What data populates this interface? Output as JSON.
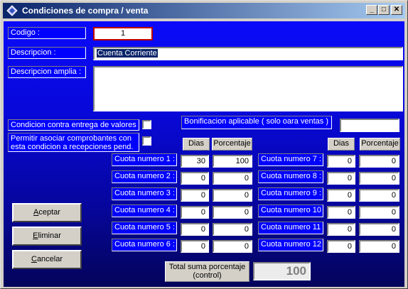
{
  "window": {
    "title": "Condiciones de compra / venta"
  },
  "fields": {
    "codigo": {
      "label": "Codigo :",
      "value": "1"
    },
    "descripcion": {
      "label": "Descripcion :",
      "value": "Cuenta Corriente"
    },
    "descripcion_amplia": {
      "label": "Descripcion amplia :",
      "value": ""
    },
    "contra_entrega": {
      "label": "Condicion contra entrega de valores :"
    },
    "permitir_asociar": {
      "label": "Permitir asociar comprobantes con esta condicion a recepciones pend."
    },
    "bonificacion": {
      "label": "Bonificacion aplicable ( solo oara ventas ) :",
      "value": ""
    }
  },
  "headers": {
    "dias": "Dias",
    "porcentaje": "Porcentaje"
  },
  "cuotas_left": [
    {
      "label": "Cuota numero 1 :",
      "dias": "30",
      "porcentaje": "100"
    },
    {
      "label": "Cuota numero 2 :",
      "dias": "0",
      "porcentaje": "0"
    },
    {
      "label": "Cuota numero 3 :",
      "dias": "0",
      "porcentaje": "0"
    },
    {
      "label": "Cuota numero 4 :",
      "dias": "0",
      "porcentaje": "0"
    },
    {
      "label": "Cuota numero 5 :",
      "dias": "0",
      "porcentaje": "0"
    },
    {
      "label": "Cuota numero 6 :",
      "dias": "0",
      "porcentaje": "0"
    }
  ],
  "cuotas_right": [
    {
      "label": "Cuota numero 7 :",
      "dias": "0",
      "porcentaje": "0"
    },
    {
      "label": "Cuota numero 8 :",
      "dias": "0",
      "porcentaje": "0"
    },
    {
      "label": "Cuota numero 9 :",
      "dias": "0",
      "porcentaje": "0"
    },
    {
      "label": "Cuota numero 10 :",
      "dias": "0",
      "porcentaje": "0"
    },
    {
      "label": "Cuota numero 11 :",
      "dias": "0",
      "porcentaje": "0"
    },
    {
      "label": "Cuota numero 12 :",
      "dias": "0",
      "porcentaje": "0"
    }
  ],
  "total": {
    "label": "Total suma porcentaje (control)",
    "value": "100"
  },
  "buttons": {
    "aceptar": {
      "mnemonic": "A",
      "rest": "ceptar"
    },
    "eliminar": {
      "mnemonic": "E",
      "rest": "liminar"
    },
    "cancelar": {
      "mnemonic": "C",
      "rest": "ancelar"
    }
  },
  "title_buttons": {
    "minimize": "_",
    "maximize": "□",
    "close": "✕"
  }
}
